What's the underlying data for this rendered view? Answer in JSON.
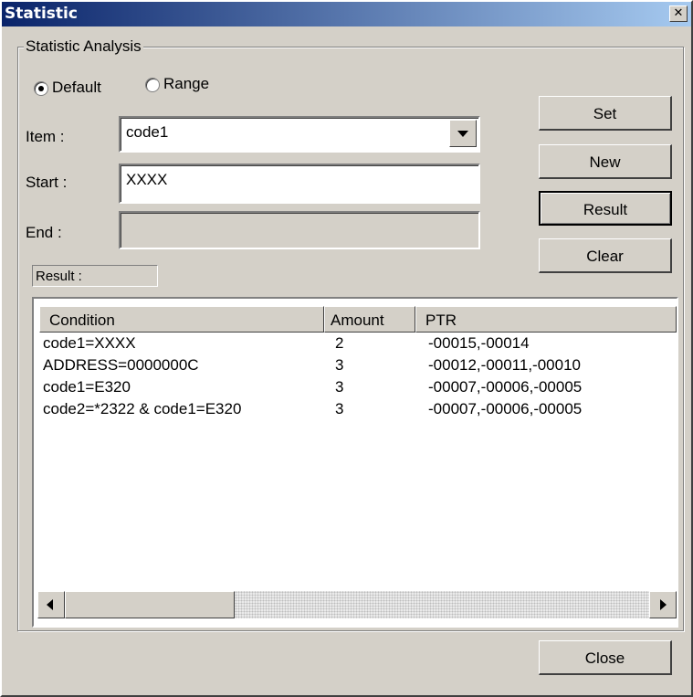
{
  "window": {
    "title": "Statistic",
    "close_glyph": "✕"
  },
  "group": {
    "label": "Statistic Analysis"
  },
  "mode": {
    "default_label": "Default",
    "range_label": "Range",
    "selected": "Default"
  },
  "item": {
    "label": "Item  :",
    "value": "code1"
  },
  "start": {
    "label": "Start  :",
    "value": "XXXX"
  },
  "end": {
    "label": "End   :",
    "value": ""
  },
  "buttons": {
    "set": "Set",
    "new": "New",
    "result": "Result",
    "clear": "Clear",
    "close": "Close"
  },
  "result_label": "Result :",
  "table": {
    "columns": [
      "Condition",
      "Amount",
      "PTR"
    ],
    "rows": [
      {
        "condition": "code1=XXXX",
        "amount": "2",
        "ptr": "-00015,-00014"
      },
      {
        "condition": "ADDRESS=0000000C",
        "amount": "3",
        "ptr": "-00012,-00011,-00010"
      },
      {
        "condition": "code1=E320",
        "amount": "3",
        "ptr": "-00007,-00006,-00005"
      },
      {
        "condition": "code2=*2322 & code1=E320",
        "amount": "3",
        "ptr": "-00007,-00006,-00005"
      }
    ]
  },
  "icons": {
    "close": "close-icon",
    "dropdown": "chevron-down-icon",
    "scroll_left": "arrow-left-icon",
    "scroll_right": "arrow-right-icon"
  },
  "colors": {
    "title_start": "#0a246a",
    "title_end": "#a6caf0",
    "face": "#d4d0c8"
  }
}
